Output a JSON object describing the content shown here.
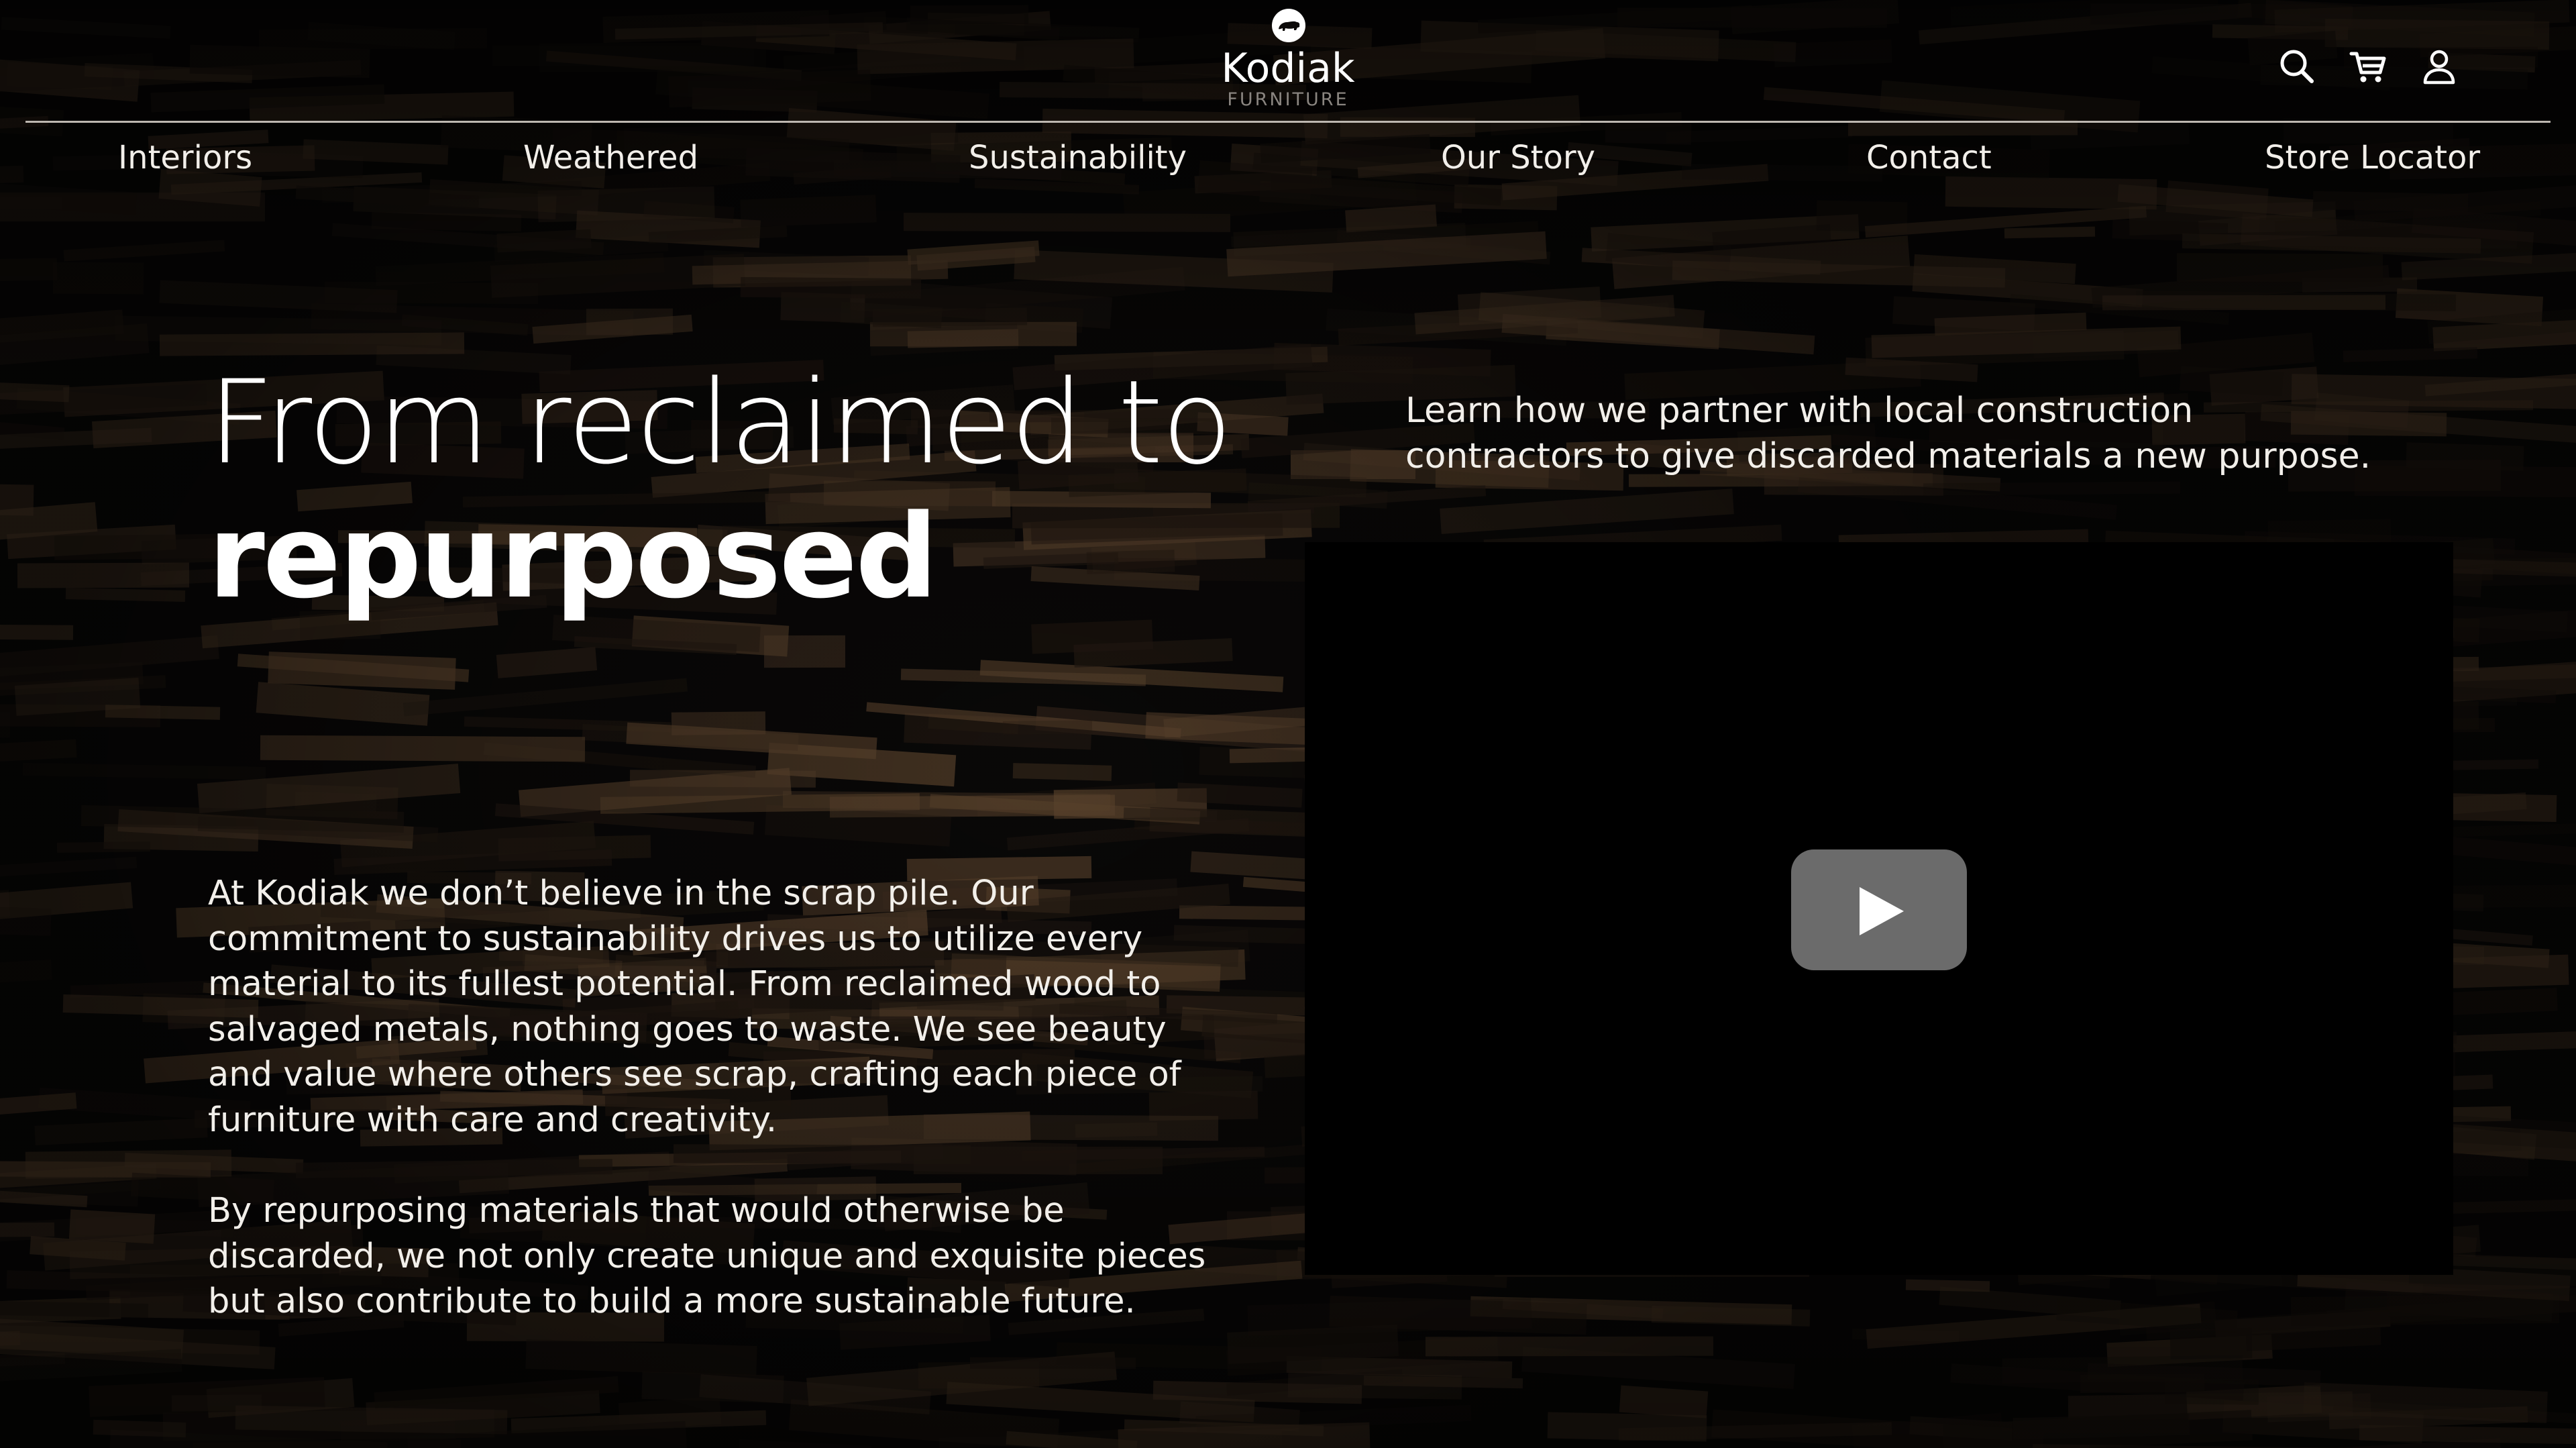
{
  "brand": {
    "name": "Kodiak",
    "tagline": "FURNITURE"
  },
  "header": {
    "icons": [
      "search-icon",
      "cart-icon",
      "user-icon"
    ]
  },
  "nav": {
    "items": [
      {
        "label": "Interiors"
      },
      {
        "label": "Weathered"
      },
      {
        "label": "Sustainability"
      },
      {
        "label": "Our Story"
      },
      {
        "label": "Contact"
      },
      {
        "label": "Store Locator"
      }
    ]
  },
  "hero": {
    "title_light": "From reclaimed to",
    "title_bold": "repurposed",
    "intro": "Learn how we partner with local construction contractors to give discarded materials a new purpose.",
    "paragraphs": [
      "At Kodiak we don’t believe in the scrap pile. Our commitment to sustainability drives us to utilize every material to its fullest potential. From reclaimed wood to salvaged metals, nothing goes to waste. We see beauty and value where others see scrap, crafting each piece of furniture with care and creativity.",
      "By repurposing materials that would otherwise be discarded, we not only create unique and exquisite pieces but also contribute to build a more sustainable future."
    ]
  },
  "video": {
    "play_icon": "play-icon"
  },
  "colors": {
    "background": "#0c0a09",
    "text": "#f2efea",
    "video_bg": "#000000",
    "play_button": "#6b6b6b",
    "wood_light": "#7a5a3c",
    "wood_dark": "#2e2117"
  }
}
